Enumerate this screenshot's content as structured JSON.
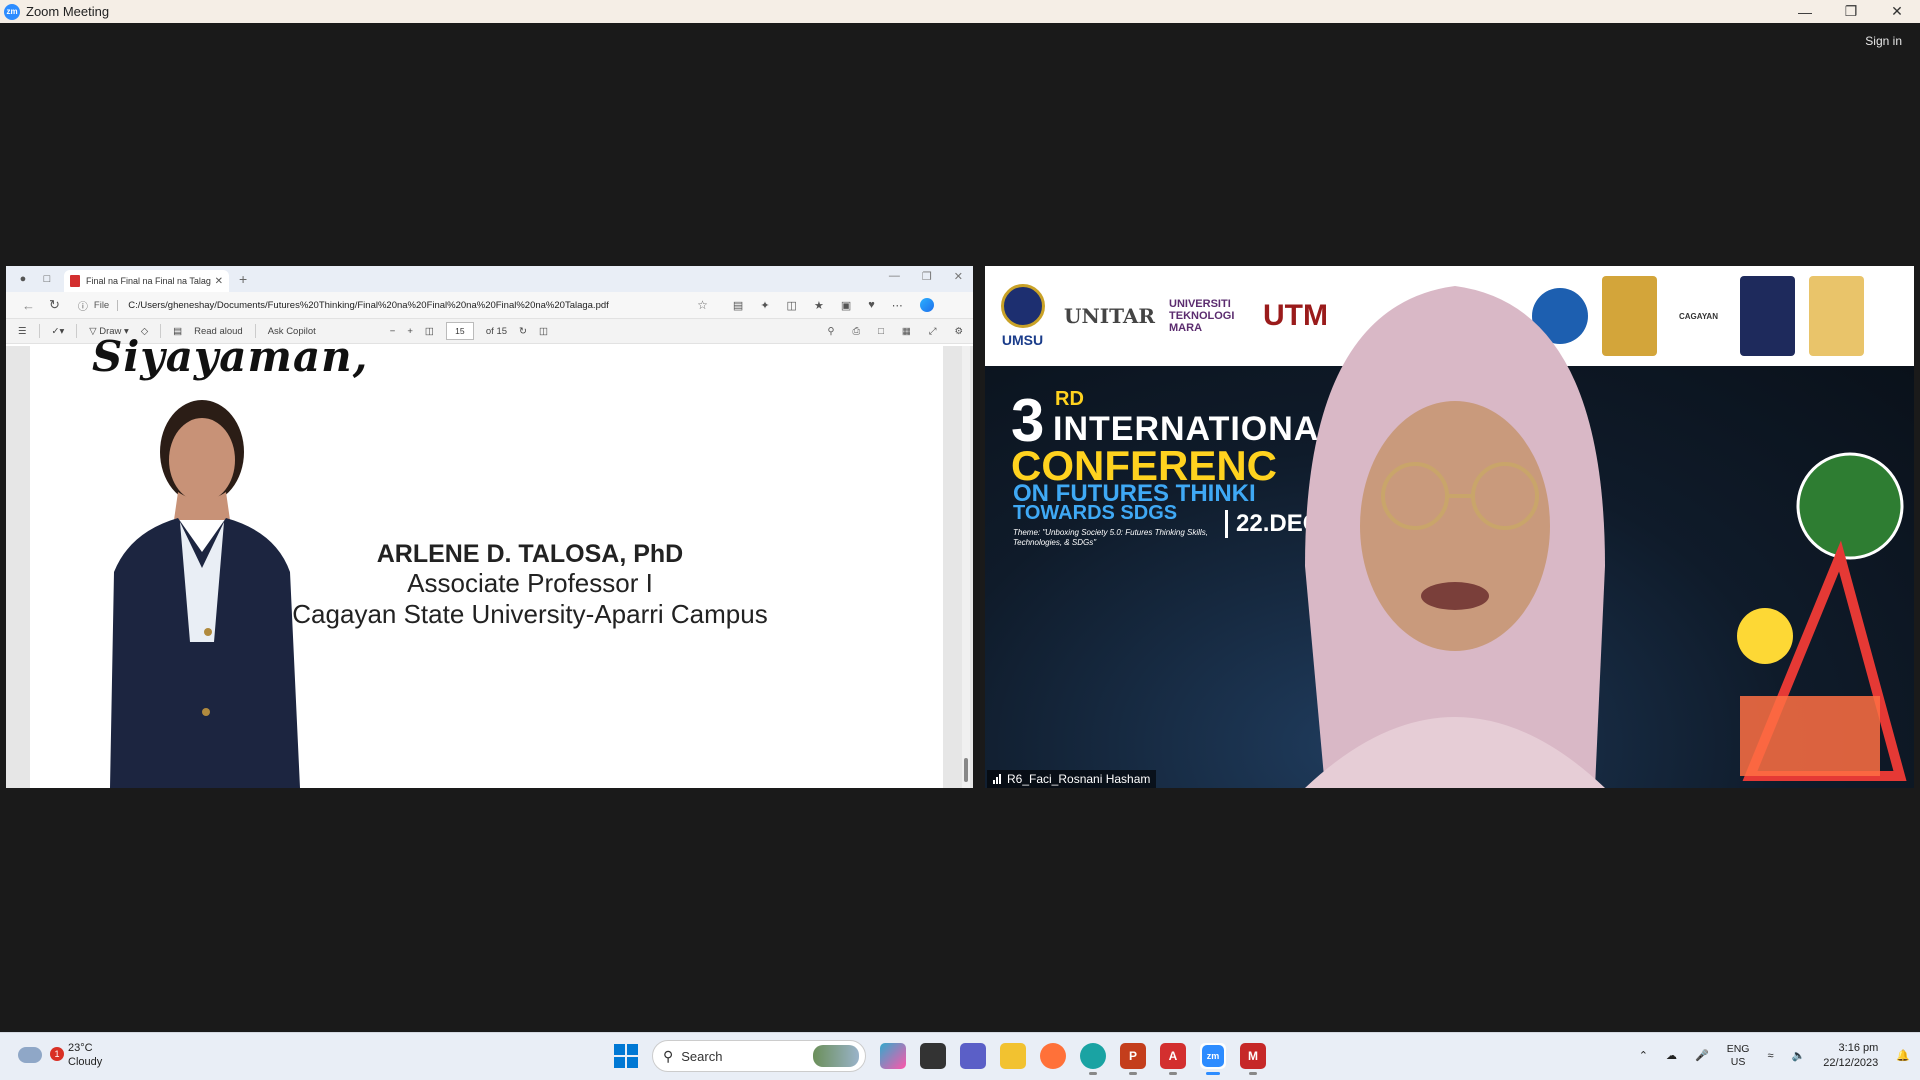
{
  "window": {
    "title": "Zoom Meeting",
    "signin": "Sign in"
  },
  "browser": {
    "tab_title": "Final na Final na Final na Talaga.pdf",
    "file_label": "File",
    "url": "C:/Users/gheneshay/Documents/Futures%20Thinking/Final%20na%20Final%20na%20Final%20na%20Talaga.pdf",
    "pdf_toolbar": {
      "draw": "Draw",
      "read_aloud": "Read aloud",
      "ask_copilot": "Ask Copilot",
      "page_current": "15",
      "page_total": "of 15"
    }
  },
  "document": {
    "script_heading": "Siyayaman,",
    "speaker_name": "ARLENE D. TALOSA, PhD",
    "speaker_role": "Associate Professor I",
    "speaker_org": "Cagayan State University-Aparri Campus"
  },
  "video": {
    "participant": "R6_Faci_Rosnani Hasham",
    "logos": {
      "umsu": "UMSU",
      "unitar": "UNITAR",
      "uitm": "UNIVERSITI TEKNOLOGI MARA",
      "utm": "UTM",
      "cagayan": "CAGAYAN"
    },
    "banner": {
      "number": "3",
      "ordinal": "RD",
      "line1": "INTERNATIONA",
      "line2": "CONFERENC",
      "line3": "ON FUTURES THINKI",
      "line4": "TOWARDS SDGS",
      "theme": "Theme: \"Unboxing Society 5.0: Futures Thinking Skills, Technologies, & SDGs\"",
      "date": "22.DEC"
    }
  },
  "taskbar": {
    "weather_temp": "23°C",
    "weather_desc": "Cloudy",
    "weather_badge": "1",
    "search_label": "Search",
    "lang_top": "ENG",
    "lang_bottom": "US",
    "time": "3:16 pm",
    "date": "22/12/2023"
  }
}
